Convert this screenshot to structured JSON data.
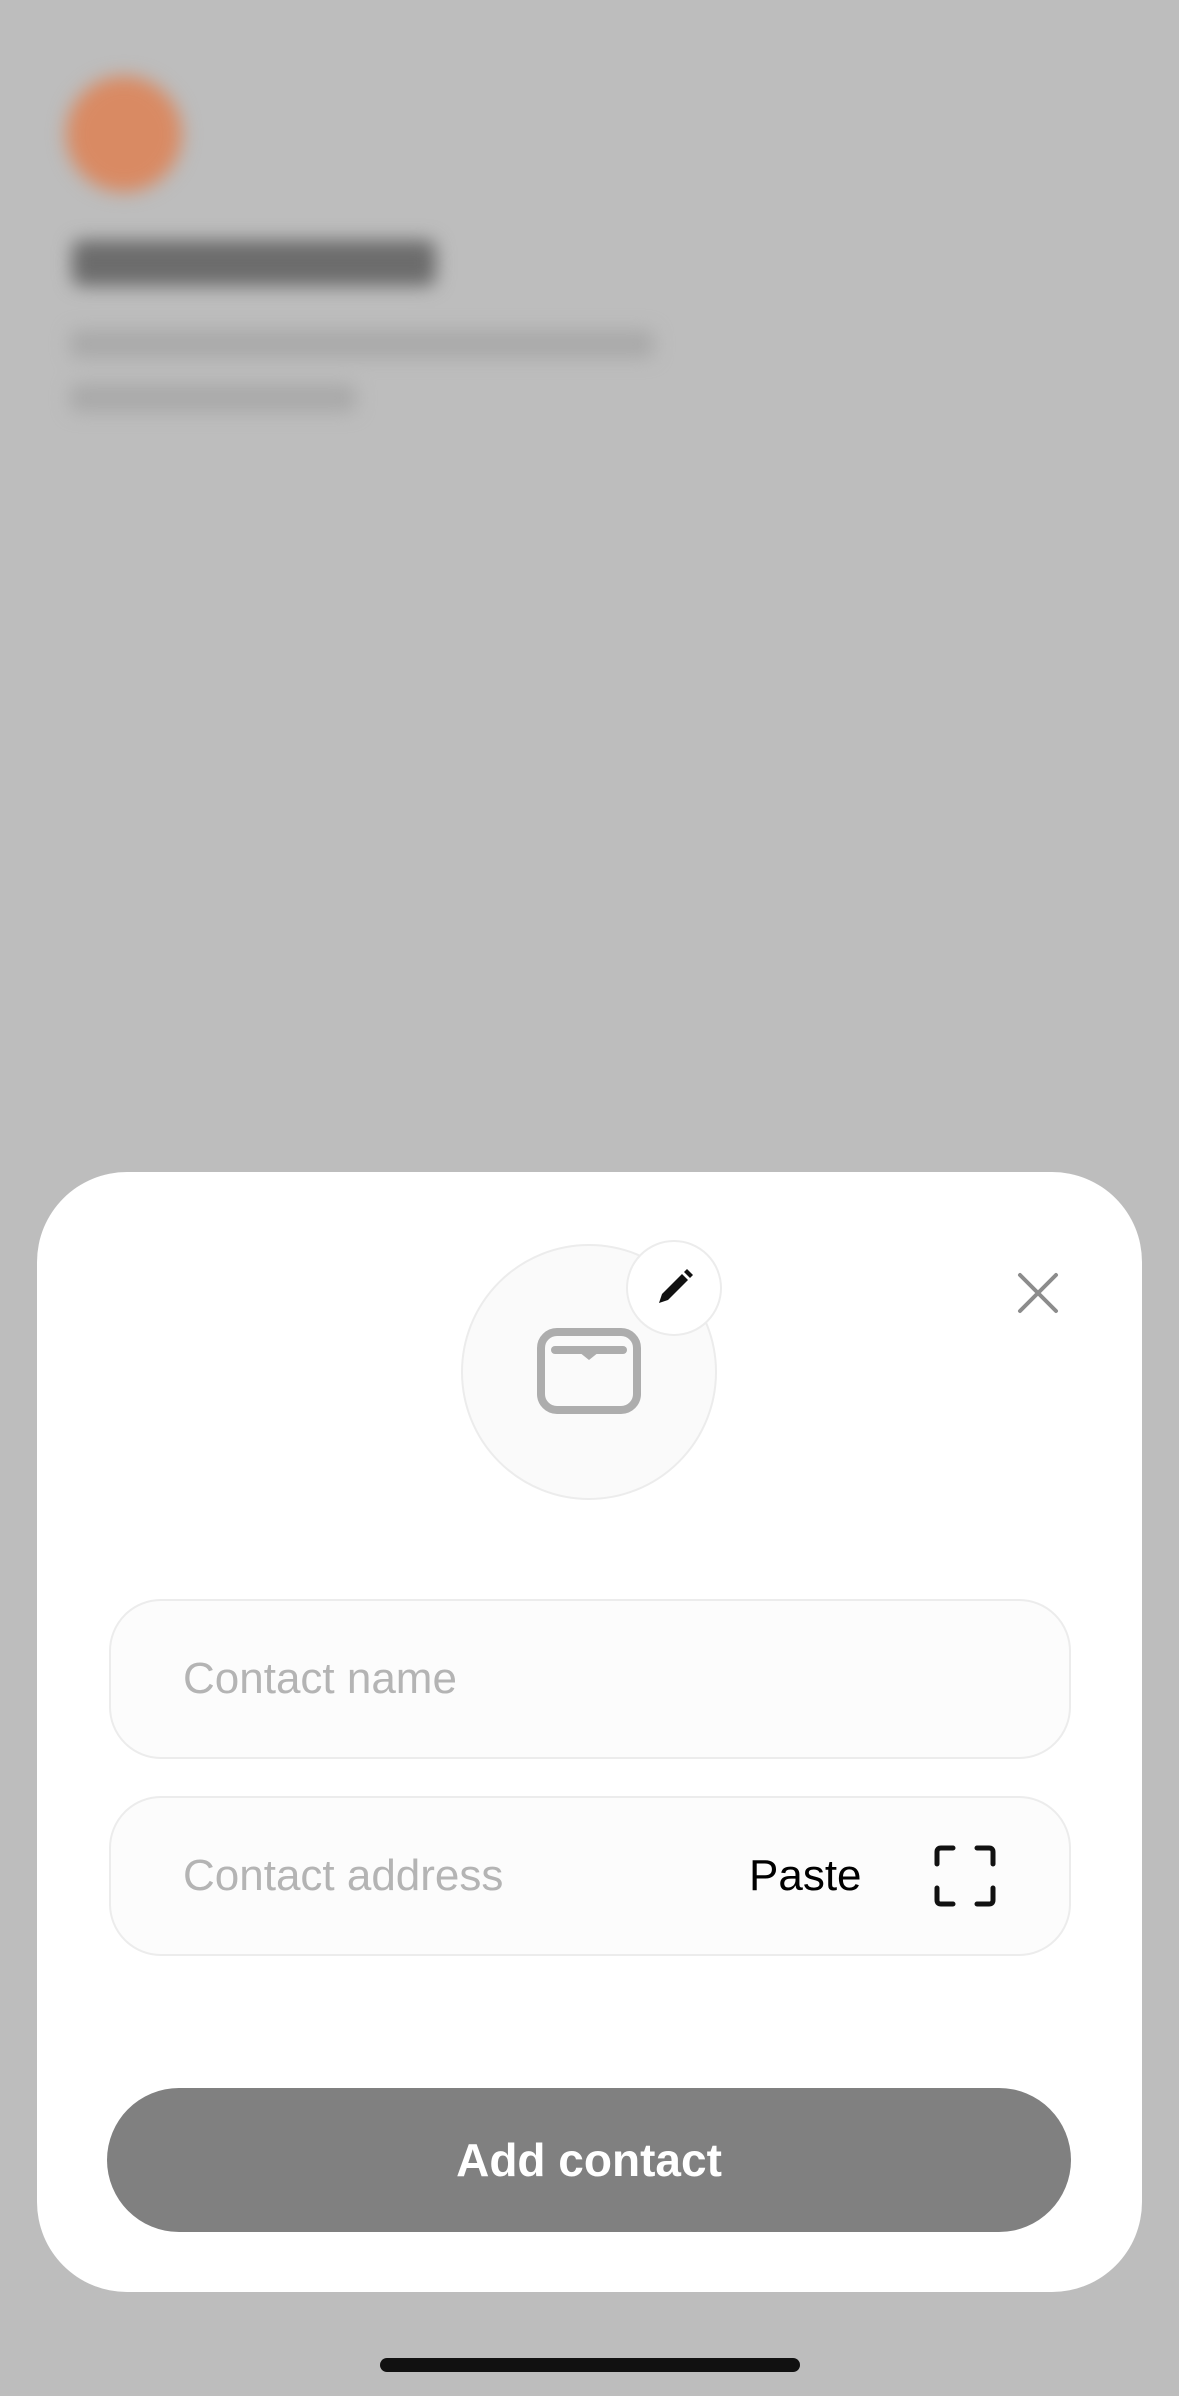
{
  "sheet": {
    "avatar": {
      "icon": "wallet-icon",
      "edit_icon": "pencil-icon"
    },
    "close_icon": "close-icon",
    "name_field": {
      "placeholder": "Contact name",
      "value": ""
    },
    "address_field": {
      "placeholder": "Contact address",
      "value": "",
      "paste_label": "Paste",
      "scan_icon": "scan-qr-icon"
    },
    "submit_label": "Add contact"
  },
  "colors": {
    "overlay": "#bdbdbd",
    "button_disabled": "#808080",
    "placeholder": "#b4b4b4"
  }
}
